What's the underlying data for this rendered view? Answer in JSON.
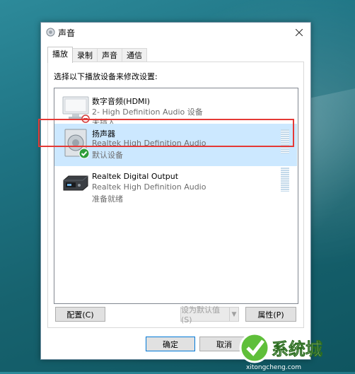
{
  "window": {
    "title": "声音"
  },
  "tabs": [
    {
      "label": "播放",
      "active": true
    },
    {
      "label": "录制",
      "active": false
    },
    {
      "label": "声音",
      "active": false
    },
    {
      "label": "通信",
      "active": false
    }
  ],
  "instruction": "选择以下播放设备来修改设置:",
  "devices": [
    {
      "name": "数字音频(HDMI)",
      "line2": "2- High Definition Audio 设备",
      "status": "未插入",
      "selected": false,
      "icon": "monitor-icon",
      "badge": "unplugged-badge"
    },
    {
      "name": "扬声器",
      "line2": "Realtek High Definition Audio",
      "status": "默认设备",
      "selected": true,
      "icon": "speaker-icon",
      "badge": "default-checkmark"
    },
    {
      "name": "Realtek Digital Output",
      "line2": "Realtek High Definition Audio",
      "status": "准备就绪",
      "selected": false,
      "icon": "digital-output-icon"
    }
  ],
  "buttons": {
    "configure": "配置(C)",
    "set_default": "设为默认值(S)",
    "properties": "属性(P)",
    "ok": "确定",
    "cancel": "取消"
  },
  "watermark": {
    "text": "系统城",
    "url": "xitongcheng.com"
  },
  "colors": {
    "selection": "#cce8ff",
    "highlight_box": "#e53935",
    "default_check": "#2e9e3a"
  }
}
